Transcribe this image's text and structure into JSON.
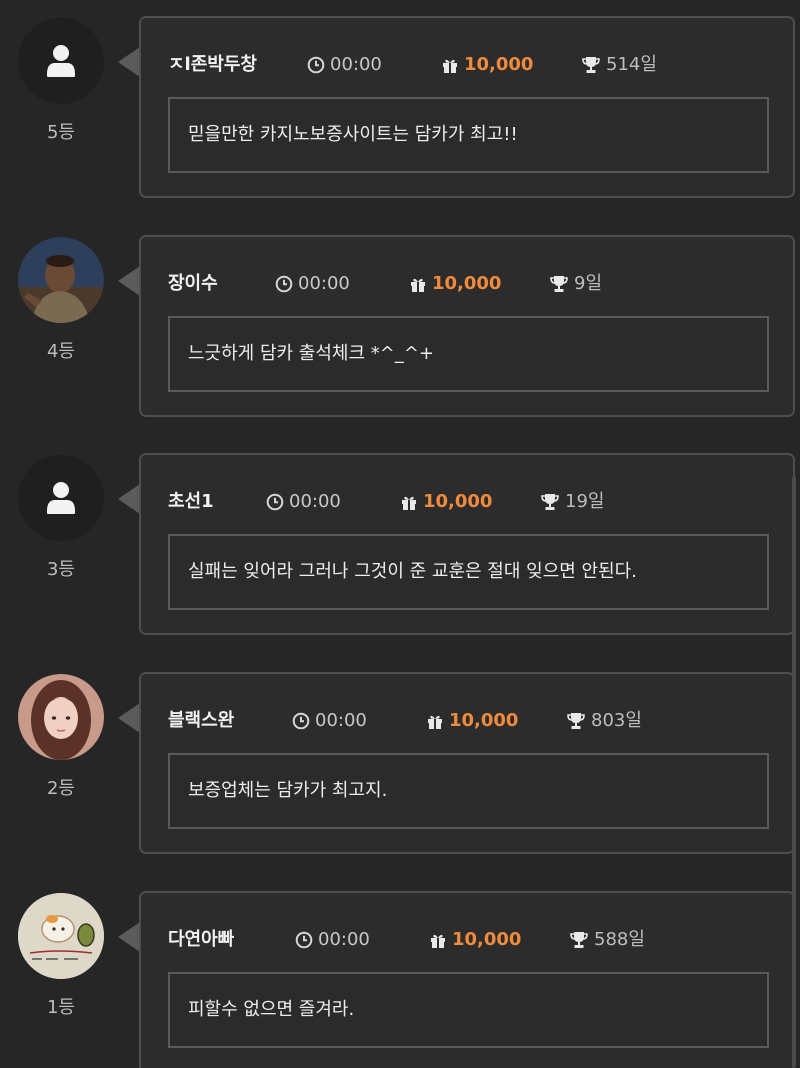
{
  "entries": [
    {
      "name": "ㅈl존박두창",
      "time": "00:00",
      "points": "10,000",
      "days": "514일",
      "message": "믿을만한 카지노보증사이트는 담카가 최고!!",
      "rank": "5등",
      "avatar": "default-user-icon"
    },
    {
      "name": "장이수",
      "time": "00:00",
      "points": "10,000",
      "days": "9일",
      "message": "느긋하게 담카 출석체크 *^_^+",
      "rank": "4등",
      "avatar": "user-photo"
    },
    {
      "name": "초선1",
      "time": "00:00",
      "points": "10,000",
      "days": "19일",
      "message": "실패는 잊어라 그러나 그것이 준 교훈은 절대 잊으면 안된다.",
      "rank": "3등",
      "avatar": "default-user-icon"
    },
    {
      "name": "블랙스완",
      "time": "00:00",
      "points": "10,000",
      "days": "803일",
      "message": "보증업체는 담카가 최고지.",
      "rank": "2등",
      "avatar": "user-photo"
    },
    {
      "name": "다연아빠",
      "time": "00:00",
      "points": "10,000",
      "days": "588일",
      "message": "피할수 없으면 즐겨라.",
      "rank": "1등",
      "avatar": "user-photo"
    }
  ],
  "colors": {
    "background": "#262626",
    "card_border": "#4e4e4e",
    "points_accent": "#f08a3c"
  },
  "icons": {
    "time": "clock-icon",
    "points": "gift-icon",
    "days": "trophy-icon"
  }
}
